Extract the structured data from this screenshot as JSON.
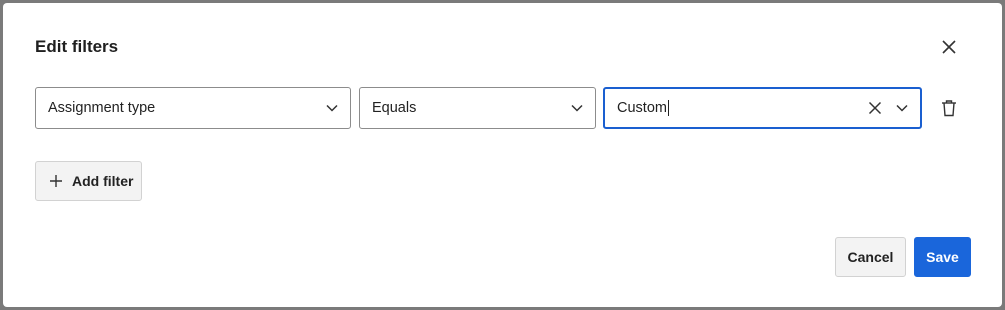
{
  "dialog": {
    "title": "Edit filters"
  },
  "filter_row": {
    "field": "Assignment type",
    "operator": "Equals",
    "value": "Custom"
  },
  "actions": {
    "add_filter_label": "Add filter",
    "cancel_label": "Cancel",
    "save_label": "Save"
  },
  "colors": {
    "primary": "#1a66db",
    "focus_border": "#1a5fd0"
  },
  "icons": {
    "close": "close-icon",
    "chevron": "chevron-down-icon",
    "clear": "clear-icon",
    "trash": "trash-icon",
    "plus": "plus-icon"
  }
}
